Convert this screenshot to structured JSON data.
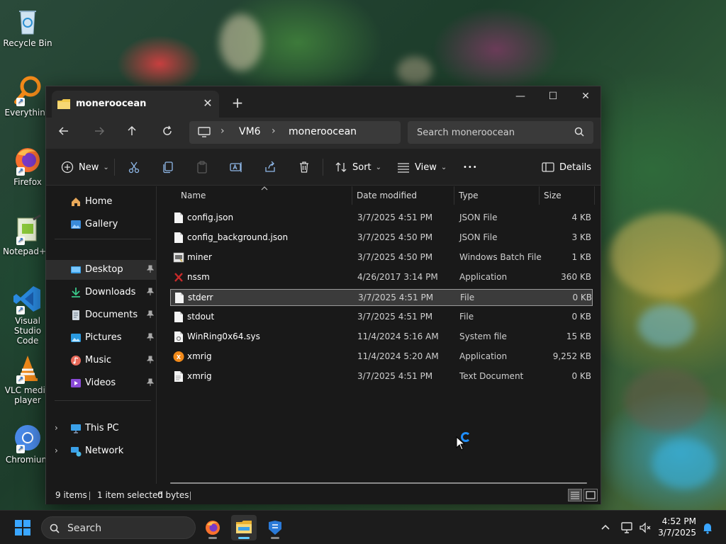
{
  "desktop": {
    "icons": [
      {
        "label": "Recycle Bin"
      },
      {
        "label": "Everything"
      },
      {
        "label": "Firefox"
      },
      {
        "label": "Notepad++"
      },
      {
        "label": "Visual Studio Code"
      },
      {
        "label": "VLC media player"
      },
      {
        "label": "Chromium"
      }
    ]
  },
  "window": {
    "tab_title": "moneroocean",
    "tab_close": "✕",
    "tab_add": "+",
    "controls": {
      "minimize": "—",
      "maximize": "☐",
      "close": "✕"
    }
  },
  "address": {
    "crumbs": [
      "VM6",
      "moneroocean"
    ],
    "separator": "›",
    "search_placeholder": "Search moneroocean"
  },
  "toolbar": {
    "new_label": "New",
    "sort_label": "Sort",
    "view_label": "View",
    "more_label": "•••",
    "details_label": "Details",
    "chevron": "⌄"
  },
  "sidebar": {
    "home": "Home",
    "gallery": "Gallery",
    "quick_access": [
      {
        "label": "Desktop"
      },
      {
        "label": "Downloads"
      },
      {
        "label": "Documents"
      },
      {
        "label": "Pictures"
      },
      {
        "label": "Music"
      },
      {
        "label": "Videos"
      }
    ],
    "this_pc": "This PC",
    "network": "Network",
    "pin_glyph": "📌",
    "chevron": "›"
  },
  "columns": {
    "name": "Name",
    "date": "Date modified",
    "type": "Type",
    "size": "Size"
  },
  "files": [
    {
      "name": "config.json",
      "date": "3/7/2025 4:51 PM",
      "type": "JSON File",
      "size": "4 KB",
      "icon": "file-icon"
    },
    {
      "name": "config_background.json",
      "date": "3/7/2025 4:50 PM",
      "type": "JSON File",
      "size": "3 KB",
      "icon": "file-icon"
    },
    {
      "name": "miner",
      "date": "3/7/2025 4:50 PM",
      "type": "Windows Batch File",
      "size": "1 KB",
      "icon": "batch-file-icon"
    },
    {
      "name": "nssm",
      "date": "4/26/2017 3:14 PM",
      "type": "Application",
      "size": "360 KB",
      "icon": "nssm-app-icon"
    },
    {
      "name": "stderr",
      "date": "3/7/2025 4:51 PM",
      "type": "File",
      "size": "0 KB",
      "icon": "file-icon"
    },
    {
      "name": "stdout",
      "date": "3/7/2025 4:51 PM",
      "type": "File",
      "size": "0 KB",
      "icon": "file-icon"
    },
    {
      "name": "WinRing0x64.sys",
      "date": "11/4/2024 5:16 AM",
      "type": "System file",
      "size": "15 KB",
      "icon": "system-file-icon"
    },
    {
      "name": "xmrig",
      "date": "11/4/2024 5:20 AM",
      "type": "Application",
      "size": "9,252 KB",
      "icon": "xmrig-app-icon"
    },
    {
      "name": "xmrig",
      "date": "3/7/2025 4:51 PM",
      "type": "Text Document",
      "size": "0 KB",
      "icon": "text-file-icon"
    }
  ],
  "selected_index": 4,
  "status": {
    "items": "9 items",
    "selected": "1 item selected",
    "bytes": "0 bytes"
  },
  "taskbar": {
    "search_label": "Search",
    "time": "4:52 PM",
    "date": "3/7/2025"
  },
  "colors": {
    "accent": "#60cdff",
    "window_bg": "#191919",
    "folder": "#f2c94c"
  }
}
